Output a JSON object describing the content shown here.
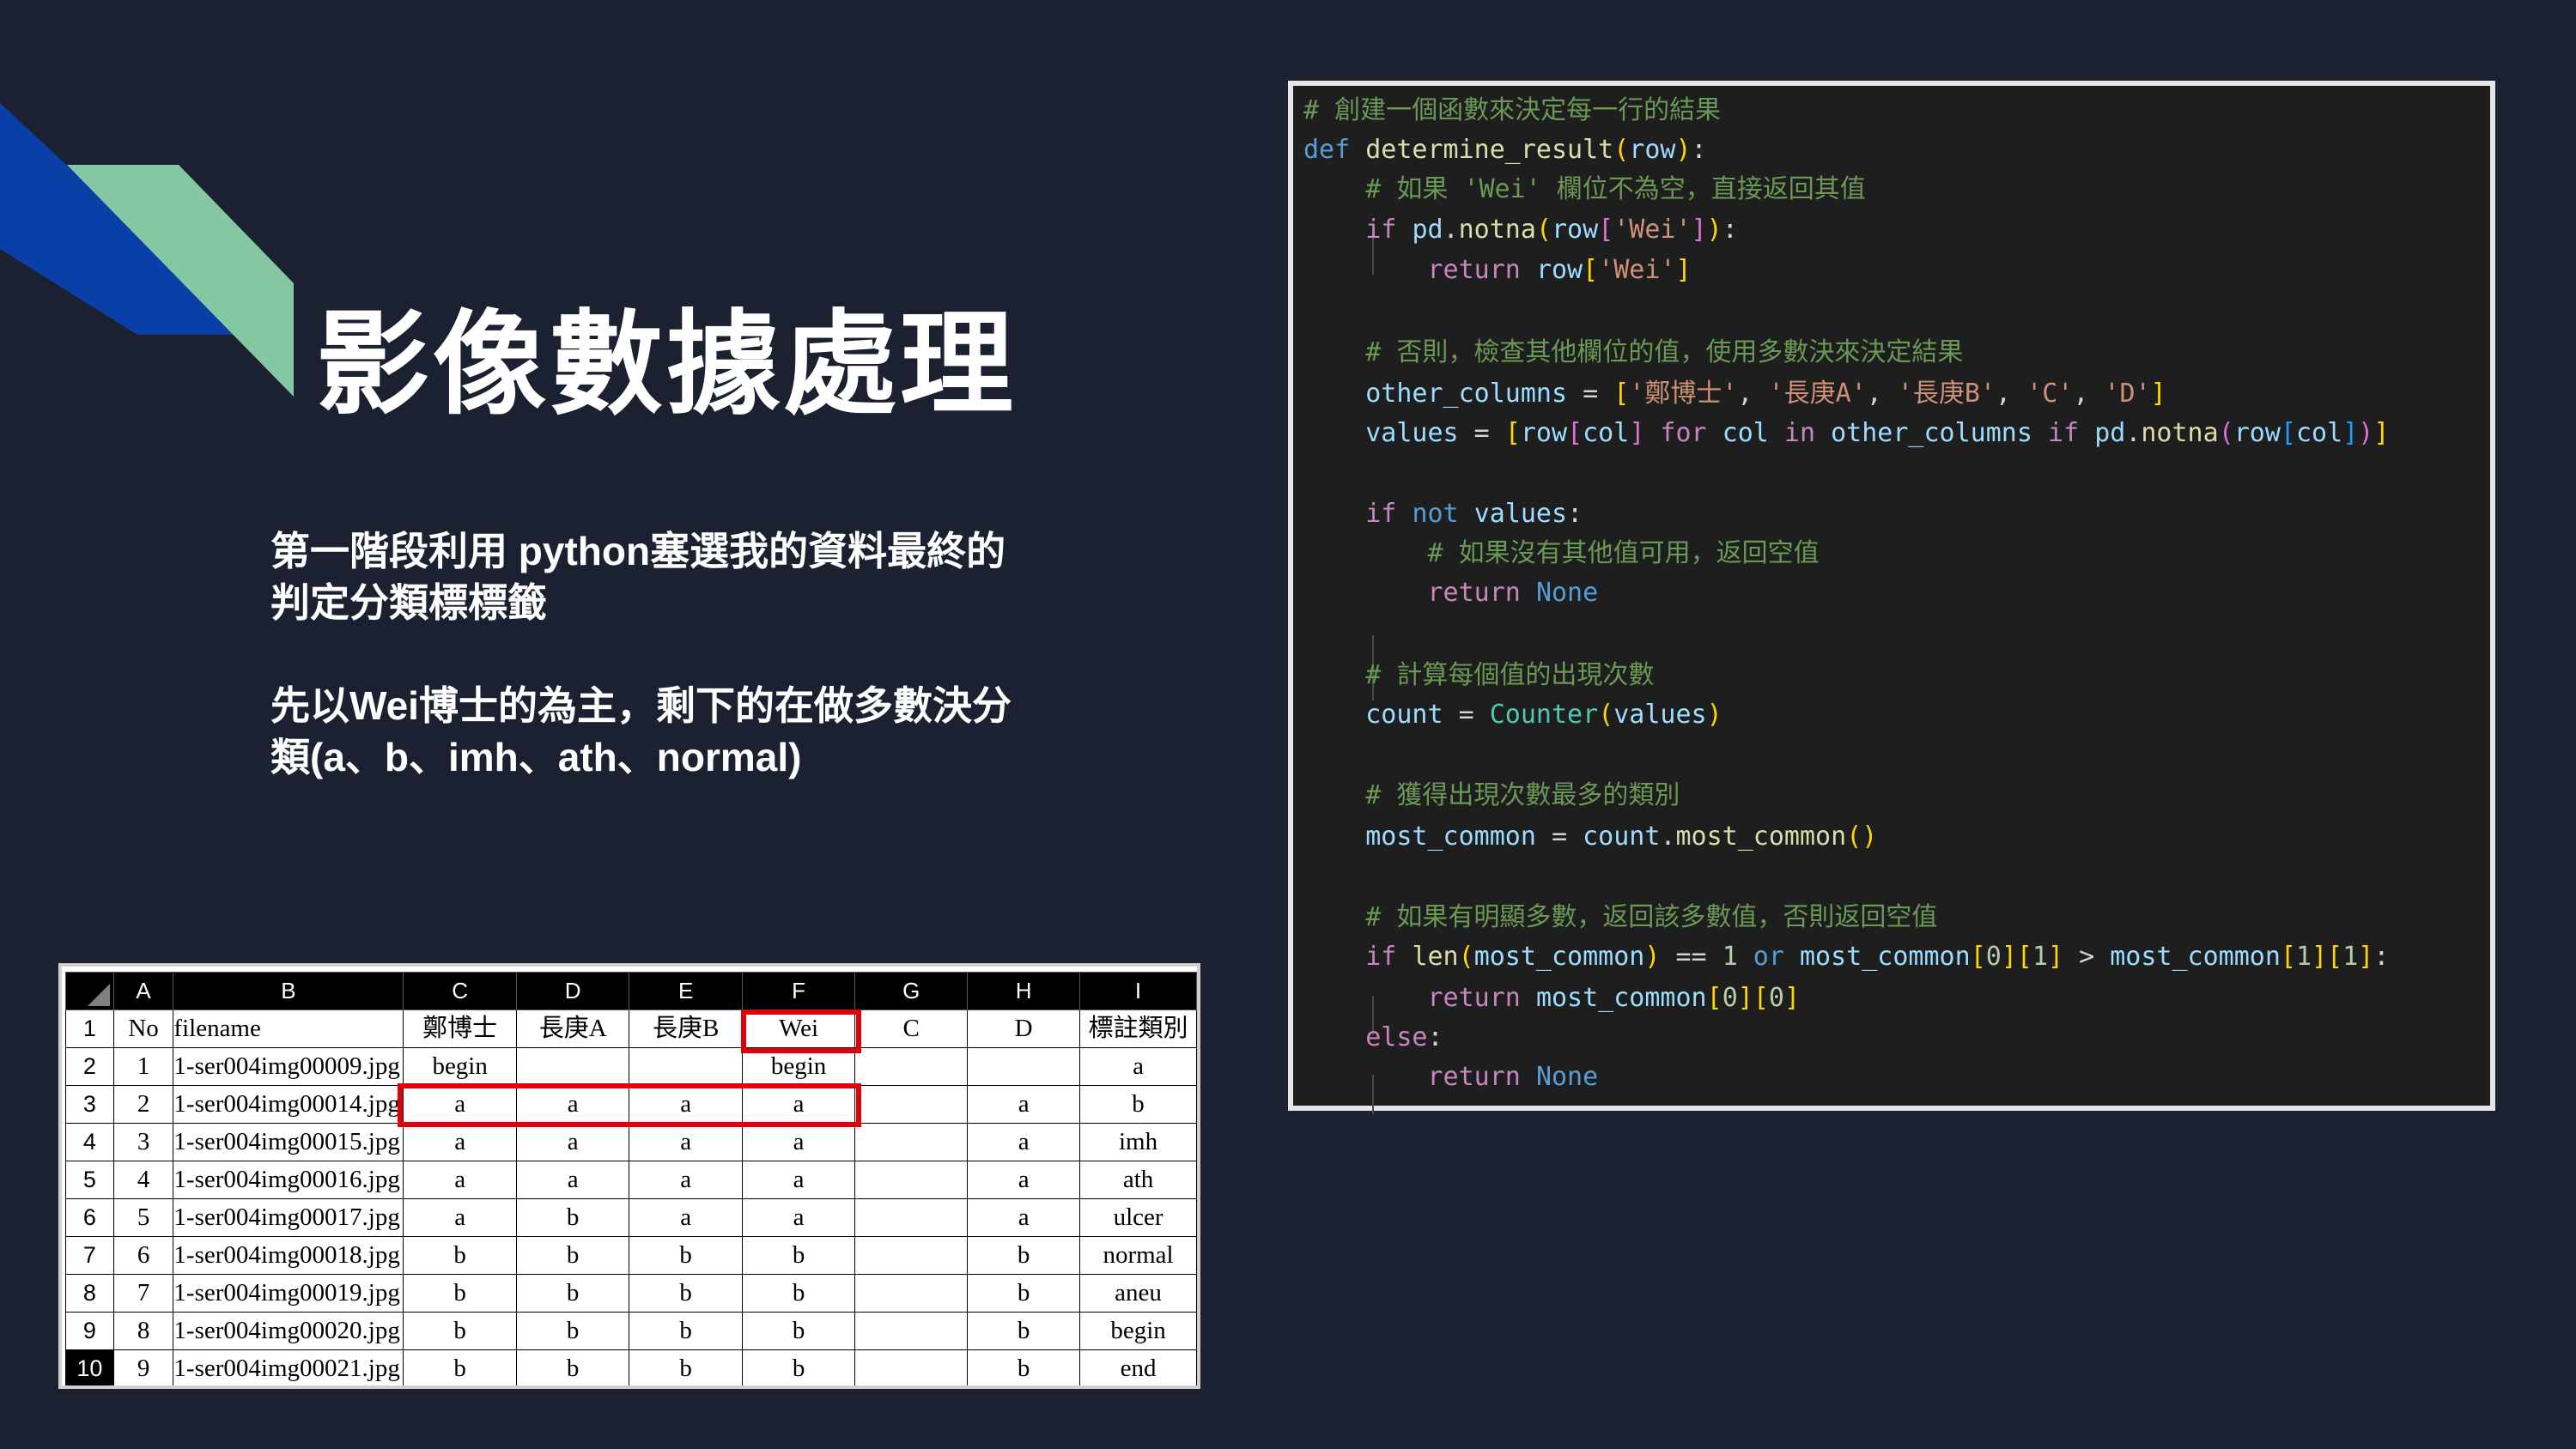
{
  "slide": {
    "title": "影像數據處理",
    "desc_line1": "第一階段利用 python塞選我的資料最終的",
    "desc_line2": "判定分類標標籤",
    "desc_line3": "先以Wei博士的為主，剩下的在做多數決分",
    "desc_line4": "類(a、b、imh、ath、normal)",
    "colors": {
      "background": "#1b2130",
      "accent_blue": "#0a3fa8",
      "accent_green": "#86c7a3",
      "highlight_red": "#e0000a"
    }
  },
  "code": {
    "lines": [
      [
        {
          "t": "# 創建一個函數來決定每一行的結果",
          "c": "c-com"
        }
      ],
      [
        {
          "t": "def ",
          "c": "c-kw"
        },
        {
          "t": "determine_result",
          "c": "c-fn"
        },
        {
          "t": "(",
          "c": "c-br"
        },
        {
          "t": "row",
          "c": "c-var"
        },
        {
          "t": ")",
          "c": "c-br"
        },
        {
          "t": ":",
          "c": ""
        }
      ],
      [
        {
          "t": "    # 如果 'Wei' 欄位不為空，直接返回其值",
          "c": "c-com"
        }
      ],
      [
        {
          "t": "    if ",
          "c": "c-ctl"
        },
        {
          "t": "pd",
          "c": "c-var"
        },
        {
          "t": ".",
          "c": ""
        },
        {
          "t": "notna",
          "c": "c-fn"
        },
        {
          "t": "(",
          "c": "c-br"
        },
        {
          "t": "row",
          "c": "c-var"
        },
        {
          "t": "[",
          "c": "c-br2"
        },
        {
          "t": "'Wei'",
          "c": "c-str"
        },
        {
          "t": "]",
          "c": "c-br2"
        },
        {
          "t": ")",
          "c": "c-br"
        },
        {
          "t": ":",
          "c": ""
        }
      ],
      [
        {
          "t": "        return ",
          "c": "c-ctl"
        },
        {
          "t": "row",
          "c": "c-var"
        },
        {
          "t": "[",
          "c": "c-br"
        },
        {
          "t": "'Wei'",
          "c": "c-str"
        },
        {
          "t": "]",
          "c": "c-br"
        }
      ],
      [],
      [
        {
          "t": "    # 否則，檢查其他欄位的值，使用多數決來決定結果",
          "c": "c-com"
        }
      ],
      [
        {
          "t": "    other_columns",
          "c": "c-var"
        },
        {
          "t": " = ",
          "c": ""
        },
        {
          "t": "[",
          "c": "c-br"
        },
        {
          "t": "'鄭博士'",
          "c": "c-str"
        },
        {
          "t": ", ",
          "c": ""
        },
        {
          "t": "'長庚A'",
          "c": "c-str"
        },
        {
          "t": ", ",
          "c": ""
        },
        {
          "t": "'長庚B'",
          "c": "c-str"
        },
        {
          "t": ", ",
          "c": ""
        },
        {
          "t": "'C'",
          "c": "c-str"
        },
        {
          "t": ", ",
          "c": ""
        },
        {
          "t": "'D'",
          "c": "c-str"
        },
        {
          "t": "]",
          "c": "c-br"
        }
      ],
      [
        {
          "t": "    values",
          "c": "c-var"
        },
        {
          "t": " = ",
          "c": ""
        },
        {
          "t": "[",
          "c": "c-br"
        },
        {
          "t": "row",
          "c": "c-var"
        },
        {
          "t": "[",
          "c": "c-br2"
        },
        {
          "t": "col",
          "c": "c-var"
        },
        {
          "t": "]",
          "c": "c-br2"
        },
        {
          "t": " for ",
          "c": "c-ctl"
        },
        {
          "t": "col",
          "c": "c-var"
        },
        {
          "t": " in ",
          "c": "c-ctl"
        },
        {
          "t": "other_columns",
          "c": "c-var"
        },
        {
          "t": " if ",
          "c": "c-ctl"
        },
        {
          "t": "pd",
          "c": "c-var"
        },
        {
          "t": ".",
          "c": ""
        },
        {
          "t": "notna",
          "c": "c-fn"
        },
        {
          "t": "(",
          "c": "c-br2"
        },
        {
          "t": "row",
          "c": "c-var"
        },
        {
          "t": "[",
          "c": "c-br3"
        },
        {
          "t": "col",
          "c": "c-var"
        },
        {
          "t": "]",
          "c": "c-br3"
        },
        {
          "t": ")",
          "c": "c-br2"
        },
        {
          "t": "]",
          "c": "c-br"
        }
      ],
      [],
      [
        {
          "t": "    if ",
          "c": "c-ctl"
        },
        {
          "t": "not ",
          "c": "c-kw"
        },
        {
          "t": "values",
          "c": "c-var"
        },
        {
          "t": ":",
          "c": ""
        }
      ],
      [
        {
          "t": "        # 如果沒有其他值可用，返回空值",
          "c": "c-com"
        }
      ],
      [
        {
          "t": "        return ",
          "c": "c-ctl"
        },
        {
          "t": "None",
          "c": "c-kw"
        }
      ],
      [],
      [
        {
          "t": "    # 計算每個值的出現次數",
          "c": "c-com"
        }
      ],
      [
        {
          "t": "    count",
          "c": "c-var"
        },
        {
          "t": " = ",
          "c": ""
        },
        {
          "t": "Counter",
          "c": "c-cls"
        },
        {
          "t": "(",
          "c": "c-br"
        },
        {
          "t": "values",
          "c": "c-var"
        },
        {
          "t": ")",
          "c": "c-br"
        }
      ],
      [],
      [
        {
          "t": "    # 獲得出現次數最多的類別",
          "c": "c-com"
        }
      ],
      [
        {
          "t": "    most_common",
          "c": "c-var"
        },
        {
          "t": " = ",
          "c": ""
        },
        {
          "t": "count",
          "c": "c-var"
        },
        {
          "t": ".",
          "c": ""
        },
        {
          "t": "most_common",
          "c": "c-fn"
        },
        {
          "t": "()",
          "c": "c-br"
        }
      ],
      [],
      [
        {
          "t": "    # 如果有明顯多數，返回該多數值，否則返回空值",
          "c": "c-com"
        }
      ],
      [
        {
          "t": "    if ",
          "c": "c-ctl"
        },
        {
          "t": "len",
          "c": "c-fn"
        },
        {
          "t": "(",
          "c": "c-br"
        },
        {
          "t": "most_common",
          "c": "c-var"
        },
        {
          "t": ")",
          "c": "c-br"
        },
        {
          "t": " == ",
          "c": ""
        },
        {
          "t": "1",
          "c": "c-num"
        },
        {
          "t": " or ",
          "c": "c-kw"
        },
        {
          "t": "most_common",
          "c": "c-var"
        },
        {
          "t": "[",
          "c": "c-br"
        },
        {
          "t": "0",
          "c": "c-num"
        },
        {
          "t": "]",
          "c": "c-br"
        },
        {
          "t": "[",
          "c": "c-br"
        },
        {
          "t": "1",
          "c": "c-num"
        },
        {
          "t": "]",
          "c": "c-br"
        },
        {
          "t": " > ",
          "c": ""
        },
        {
          "t": "most_common",
          "c": "c-var"
        },
        {
          "t": "[",
          "c": "c-br"
        },
        {
          "t": "1",
          "c": "c-num"
        },
        {
          "t": "]",
          "c": "c-br"
        },
        {
          "t": "[",
          "c": "c-br"
        },
        {
          "t": "1",
          "c": "c-num"
        },
        {
          "t": "]",
          "c": "c-br"
        },
        {
          "t": ":",
          "c": ""
        }
      ],
      [
        {
          "t": "        return ",
          "c": "c-ctl"
        },
        {
          "t": "most_common",
          "c": "c-var"
        },
        {
          "t": "[",
          "c": "c-br"
        },
        {
          "t": "0",
          "c": "c-num"
        },
        {
          "t": "]",
          "c": "c-br"
        },
        {
          "t": "[",
          "c": "c-br"
        },
        {
          "t": "0",
          "c": "c-num"
        },
        {
          "t": "]",
          "c": "c-br"
        }
      ],
      [
        {
          "t": "    else",
          "c": "c-ctl"
        },
        {
          "t": ":",
          "c": ""
        }
      ],
      [
        {
          "t": "        return ",
          "c": "c-ctl"
        },
        {
          "t": "None",
          "c": "c-kw"
        }
      ]
    ]
  },
  "sheet": {
    "column_letters": [
      "A",
      "B",
      "C",
      "D",
      "E",
      "F",
      "G",
      "H",
      "I"
    ],
    "header_row": {
      "row": "1",
      "cells": [
        "No",
        "filename",
        "鄭博士",
        "長庚A",
        "長庚B",
        "Wei",
        "C",
        "D",
        "標註類別"
      ]
    },
    "rows": [
      {
        "row": "2",
        "cells": [
          "1",
          "1-ser004img00009.jpg",
          "begin",
          "",
          "",
          "begin",
          "",
          "",
          "a"
        ]
      },
      {
        "row": "3",
        "cells": [
          "2",
          "1-ser004img00014.jpg",
          "a",
          "a",
          "a",
          "a",
          "",
          "a",
          "b"
        ]
      },
      {
        "row": "4",
        "cells": [
          "3",
          "1-ser004img00015.jpg",
          "a",
          "a",
          "a",
          "a",
          "",
          "a",
          "imh"
        ]
      },
      {
        "row": "5",
        "cells": [
          "4",
          "1-ser004img00016.jpg",
          "a",
          "a",
          "a",
          "a",
          "",
          "a",
          "ath"
        ]
      },
      {
        "row": "6",
        "cells": [
          "5",
          "1-ser004img00017.jpg",
          "a",
          "b",
          "a",
          "a",
          "",
          "a",
          "ulcer"
        ]
      },
      {
        "row": "7",
        "cells": [
          "6",
          "1-ser004img00018.jpg",
          "b",
          "b",
          "b",
          "b",
          "",
          "b",
          "normal"
        ]
      },
      {
        "row": "8",
        "cells": [
          "7",
          "1-ser004img00019.jpg",
          "b",
          "b",
          "b",
          "b",
          "",
          "b",
          "aneu"
        ]
      },
      {
        "row": "9",
        "cells": [
          "8",
          "1-ser004img00020.jpg",
          "b",
          "b",
          "b",
          "b",
          "",
          "b",
          "begin"
        ]
      },
      {
        "row": "10",
        "cells": [
          "9",
          "1-ser004img00021.jpg",
          "b",
          "b",
          "b",
          "b",
          "",
          "b",
          "end"
        ]
      }
    ]
  }
}
